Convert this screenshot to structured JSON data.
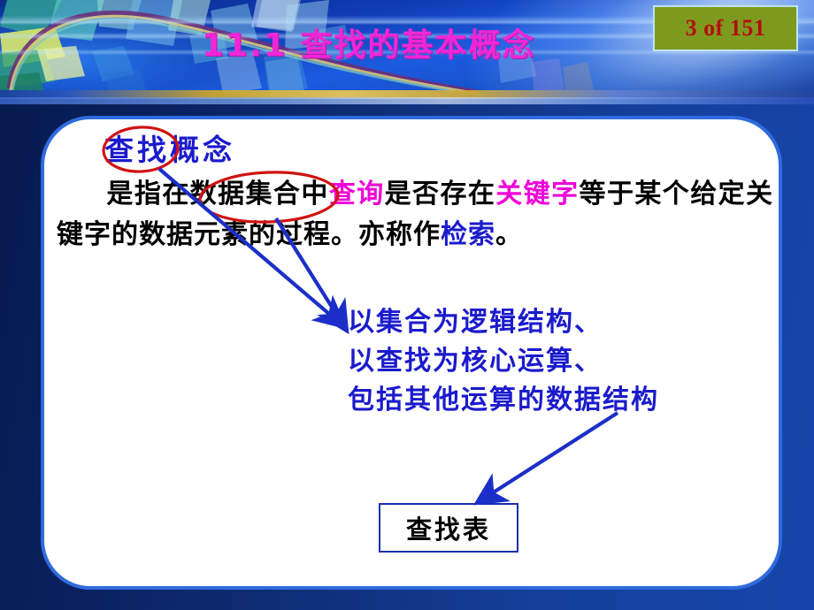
{
  "slide": {
    "title": "11.1  查找的基本概念",
    "page_counter": "3 of 151",
    "title_color": "#ef27d8",
    "counter_bg": "#7d9a1e",
    "counter_fg": "#b40d0d",
    "card_border_color": "#2f6bdd",
    "accent_magenta": "#ee00d8",
    "accent_blue": "#1b1bcd",
    "accent_red": "#d01212"
  },
  "content": {
    "heading": {
      "circled": "查找",
      "rest": "概念"
    },
    "paragraph": {
      "seg1": "是指在",
      "seg2_circled": "数据集合",
      "seg3": "中",
      "seg4_magenta": "查询",
      "seg5": "是否存在",
      "seg6_magenta": "关键字",
      "seg7": "等于某个给定关键字的数据元素的过程。亦称作",
      "seg8_blue": "检索",
      "seg9": "。"
    },
    "blue_lines": [
      "以集合为逻辑结构、",
      "以查找为核心运算、",
      "包括其他运算的数据结构"
    ],
    "boxed_term": "查找表"
  },
  "annotations": {
    "ellipse_chazhao": "red-ellipse-around-chazhao",
    "ellipse_shujujihe": "red-ellipse-around-shujujihe",
    "arrow_from_chazhao": "blue-arrow-chazhao-to-definition",
    "arrow_from_shujujihe": "blue-arrow-shujujihe-to-definition",
    "arrow_to_box": "blue-arrow-definition-to-chazhaobiao"
  }
}
